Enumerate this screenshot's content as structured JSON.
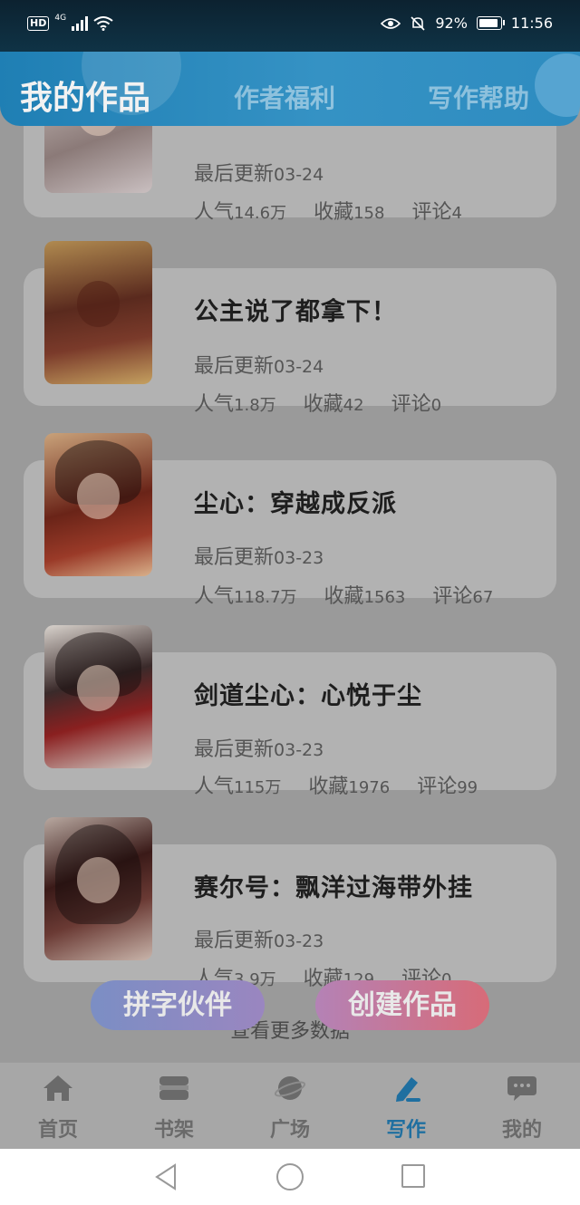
{
  "status_bar": {
    "hd": "HD",
    "network": "4G",
    "battery": "92%",
    "time": "11:56"
  },
  "header": {
    "tabs": [
      {
        "label": "我的作品",
        "active": true
      },
      {
        "label": "作者福利",
        "active": false
      },
      {
        "label": "写作帮助",
        "active": false
      }
    ]
  },
  "works": [
    {
      "title": "",
      "update_label": "最后更新",
      "update_date": "03-24",
      "popularity_label": "人气",
      "popularity": "14.6万",
      "favorites_label": "收藏",
      "favorites": "158",
      "comments_label": "评论",
      "comments": "4"
    },
    {
      "title": "公主说了都拿下！",
      "update_label": "最后更新",
      "update_date": "03-24",
      "popularity_label": "人气",
      "popularity": "1.8万",
      "favorites_label": "收藏",
      "favorites": "42",
      "comments_label": "评论",
      "comments": "0"
    },
    {
      "title": "尘心：穿越成反派",
      "update_label": "最后更新",
      "update_date": "03-23",
      "popularity_label": "人气",
      "popularity": "118.7万",
      "favorites_label": "收藏",
      "favorites": "1563",
      "comments_label": "评论",
      "comments": "67"
    },
    {
      "title": "剑道尘心：心悦于尘",
      "update_label": "最后更新",
      "update_date": "03-23",
      "popularity_label": "人气",
      "popularity": "115万",
      "favorites_label": "收藏",
      "favorites": "1976",
      "comments_label": "评论",
      "comments": "99"
    },
    {
      "title": "赛尔号：飘洋过海带外挂",
      "update_label": "最后更新",
      "update_date": "03-23",
      "popularity_label": "人气",
      "popularity": "3.9万",
      "favorites_label": "收藏",
      "favorites": "129",
      "comments_label": "评论",
      "comments": "0"
    }
  ],
  "actions": {
    "partner_label": "拼字伙伴",
    "create_label": "创建作品",
    "more_label": "查看更多数据"
  },
  "bottom_nav": [
    {
      "label": "首页",
      "icon": "home-icon",
      "active": false
    },
    {
      "label": "书架",
      "icon": "bookshelf-icon",
      "active": false
    },
    {
      "label": "广场",
      "icon": "planet-icon",
      "active": false
    },
    {
      "label": "写作",
      "icon": "pen-icon",
      "active": true
    },
    {
      "label": "我的",
      "icon": "chat-bubble-icon",
      "active": false
    }
  ],
  "colors": {
    "header_blue": "#2e8cc0",
    "active_nav": "#1f6fa0",
    "partner_button": "#8a8ac2",
    "create_button": "#c8777f",
    "overlay_gray": "#9a9a9a"
  }
}
